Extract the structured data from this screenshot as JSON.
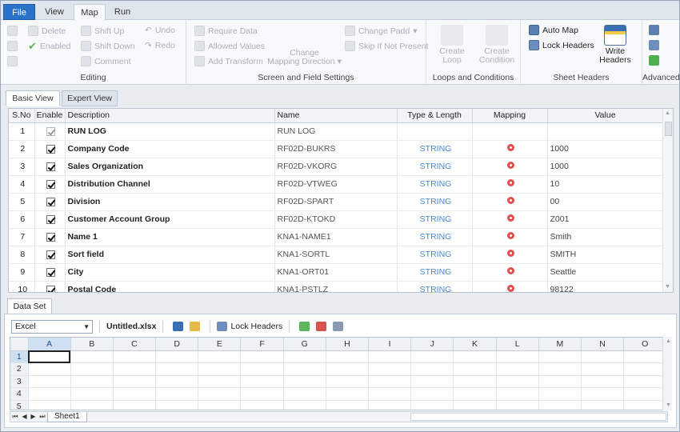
{
  "ribbon_tabs": [
    {
      "label": "File"
    },
    {
      "label": "View"
    },
    {
      "label": "Map"
    },
    {
      "label": "Run"
    }
  ],
  "editing": {
    "label": "Editing",
    "delete": "Delete",
    "enabled": "Enabled",
    "shift_up": "Shift Up",
    "shift_down": "Shift Down",
    "comment": "Comment",
    "undo": "Undo",
    "redo": "Redo"
  },
  "screen_field": {
    "label": "Screen and Field Settings",
    "require_data": "Require Data",
    "allowed_values": "Allowed Values",
    "add_transform": "Add Transform",
    "change_mapping": "Change",
    "change_mapping_2": "Mapping Direction",
    "change_padding": "Change Padd",
    "skip_if_not_present": "Skip If Not Present"
  },
  "loops": {
    "label": "Loops and Conditions",
    "create_loop": "Create",
    "create_loop_2": "Loop",
    "create_condition": "Create",
    "create_condition_2": "Condition"
  },
  "sheet_headers": {
    "label": "Sheet Headers",
    "auto_map": "Auto Map",
    "lock_headers": "Lock Headers",
    "write_headers": "Write",
    "write_headers_2": "Headers"
  },
  "advanced": {
    "label": "Advanced"
  },
  "view_tabs": [
    {
      "label": "Basic View"
    },
    {
      "label": "Expert View"
    }
  ],
  "grid": {
    "columns": [
      "S.No",
      "Enable",
      "Description",
      "Name",
      "Type & Length",
      "Mapping",
      "Value"
    ],
    "rows": [
      {
        "no": "1",
        "enabled": true,
        "disabled": true,
        "description": "RUN LOG",
        "name": "RUN LOG",
        "type": "",
        "mapped": false,
        "value": ""
      },
      {
        "no": "2",
        "enabled": true,
        "disabled": false,
        "description": "Company Code",
        "name": "RF02D-BUKRS",
        "type": "STRING",
        "mapped": true,
        "value": "1000"
      },
      {
        "no": "3",
        "enabled": true,
        "disabled": false,
        "description": "Sales Organization",
        "name": "RF02D-VKORG",
        "type": "STRING",
        "mapped": true,
        "value": "1000"
      },
      {
        "no": "4",
        "enabled": true,
        "disabled": false,
        "description": "Distribution Channel",
        "name": "RF02D-VTWEG",
        "type": "STRING",
        "mapped": true,
        "value": "10"
      },
      {
        "no": "5",
        "enabled": true,
        "disabled": false,
        "description": "Division",
        "name": "RF02D-SPART",
        "type": "STRING",
        "mapped": true,
        "value": "00"
      },
      {
        "no": "6",
        "enabled": true,
        "disabled": false,
        "description": "Customer Account Group",
        "name": "RF02D-KTOKD",
        "type": "STRING",
        "mapped": true,
        "value": "Z001"
      },
      {
        "no": "7",
        "enabled": true,
        "disabled": false,
        "description": "Name 1",
        "name": "KNA1-NAME1",
        "type": "STRING",
        "mapped": true,
        "value": "Smith"
      },
      {
        "no": "8",
        "enabled": true,
        "disabled": false,
        "description": "Sort field",
        "name": "KNA1-SORTL",
        "type": "STRING",
        "mapped": true,
        "value": "SMITH"
      },
      {
        "no": "9",
        "enabled": true,
        "disabled": false,
        "description": "City",
        "name": "KNA1-ORT01",
        "type": "STRING",
        "mapped": true,
        "value": "Seattle"
      },
      {
        "no": "10",
        "enabled": true,
        "disabled": false,
        "description": "Postal Code",
        "name": "KNA1-PSTLZ",
        "type": "STRING",
        "mapped": true,
        "value": "98122"
      }
    ]
  },
  "dataset": {
    "tab_label": "Data Set",
    "source_type": "Excel",
    "file_name": "Untitled.xlsx",
    "lock_headers": "Lock Headers",
    "columns": [
      "A",
      "B",
      "C",
      "D",
      "E",
      "F",
      "G",
      "H",
      "I",
      "J",
      "K",
      "L",
      "M",
      "N",
      "O"
    ],
    "rows": [
      "1",
      "2",
      "3",
      "4",
      "5"
    ],
    "sheet_name": "Sheet1"
  },
  "colors": {
    "accent": "#2b73c9",
    "type_text": "#4a8ad0",
    "mapping_pin": "#e05050"
  }
}
